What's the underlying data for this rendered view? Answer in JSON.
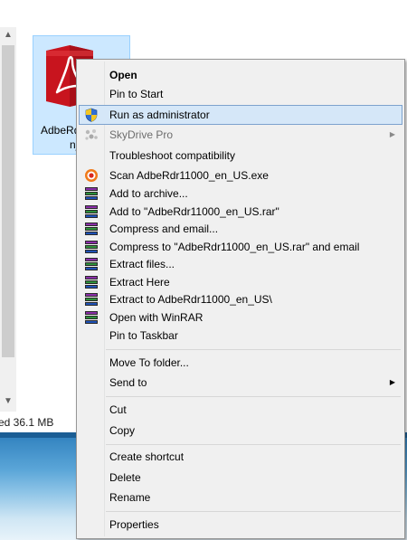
{
  "file": {
    "name_line1": "AdbeRd",
    "name_line2": "n_",
    "icon": "adobe-reader-installer-icon"
  },
  "status_bar": {
    "text": "ed  36.1 MB"
  },
  "context_menu": {
    "items": [
      {
        "label": "Open",
        "icon": null,
        "bold": true
      },
      {
        "label": "Pin to Start",
        "icon": null
      },
      {
        "label": "Run as administrator",
        "icon": "uac-shield-icon",
        "highlighted": true
      },
      {
        "label": "SkyDrive Pro",
        "icon": "skydrive-icon",
        "disabled": true,
        "submenu": true
      },
      {
        "label": "Troubleshoot compatibility",
        "icon": null
      },
      {
        "label": "Scan AdbeRdr11000_en_US.exe",
        "icon": "antivirus-scan-icon"
      },
      {
        "label": "Add to archive...",
        "icon": "winrar-icon"
      },
      {
        "label": "Add to \"AdbeRdr11000_en_US.rar\"",
        "icon": "winrar-icon"
      },
      {
        "label": "Compress and email...",
        "icon": "winrar-icon"
      },
      {
        "label": "Compress to \"AdbeRdr11000_en_US.rar\" and email",
        "icon": "winrar-icon"
      },
      {
        "label": "Extract files...",
        "icon": "winrar-icon"
      },
      {
        "label": "Extract Here",
        "icon": "winrar-icon"
      },
      {
        "label": "Extract to AdbeRdr11000_en_US\\",
        "icon": "winrar-icon"
      },
      {
        "label": "Open with WinRAR",
        "icon": "winrar-icon"
      },
      {
        "label": "Pin to Taskbar",
        "icon": null
      },
      {
        "label": "Move To folder...",
        "icon": null
      },
      {
        "label": "Send to",
        "icon": null,
        "submenu": true
      },
      {
        "label": "Cut",
        "icon": null
      },
      {
        "label": "Copy",
        "icon": null
      },
      {
        "label": "Create shortcut",
        "icon": null
      },
      {
        "label": "Delete",
        "icon": null
      },
      {
        "label": "Rename",
        "icon": null
      },
      {
        "label": "Properties",
        "icon": null
      }
    ]
  },
  "colors": {
    "highlight_bg": "#d5e7f8",
    "highlight_border": "#7da2ce",
    "menu_bg": "#f0f0f0",
    "selection_tile": "#cce8ff",
    "adobe_red": "#c8141e"
  }
}
